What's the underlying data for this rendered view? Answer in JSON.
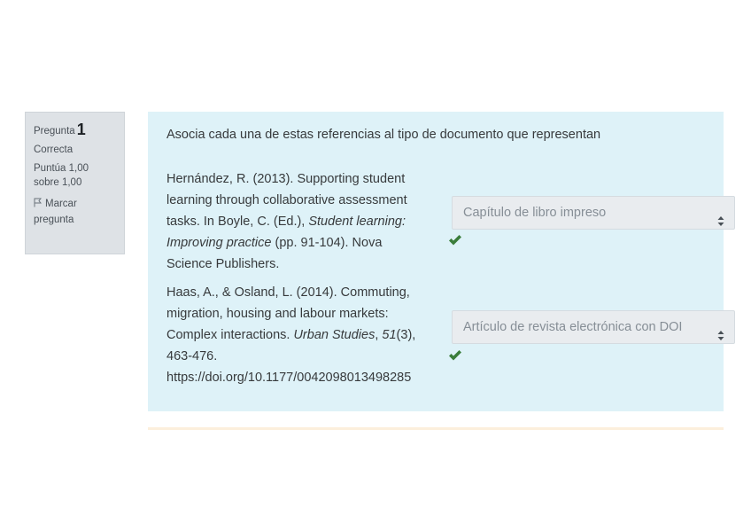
{
  "info": {
    "question_label": "Pregunta",
    "question_number": "1",
    "state": "Correcta",
    "grade_line1": "Puntúa 1,00",
    "grade_line2": "sobre 1,00",
    "flag_line1": "Marcar",
    "flag_line2": "pregunta",
    "flag_icon": "flag-icon"
  },
  "question": {
    "text": "Asocia cada una de estas referencias al tipo de documento que representan",
    "items": [
      {
        "lines": [
          "Hernández, R. (2013). Supporting student",
          "learning through collaborative assessment",
          "tasks. In Boyle, C. (Ed.), ",
          "Student learning:",
          "Improving practice",
          " (pp. 91-104). Nova",
          "Science Publishers."
        ],
        "selected": "Capítulo de libro impreso",
        "feedback_icon": "check-icon"
      },
      {
        "lines": [
          "Haas, A., & Osland, L. (2014). Commuting,",
          "migration, housing and labour markets:",
          "Complex interactions. ",
          "Urban Studies",
          ", ",
          "51",
          "(3),",
          "463-476.",
          "https://doi.org/10.1177/0042098013498285"
        ],
        "selected": "Artículo de revista electrónica con DOI",
        "feedback_icon": "check-icon"
      }
    ]
  },
  "colors": {
    "content_bg": "#def2f8",
    "info_bg": "#dee2e6",
    "check": "#3a7d3a",
    "select_bg": "#e9ecef"
  }
}
